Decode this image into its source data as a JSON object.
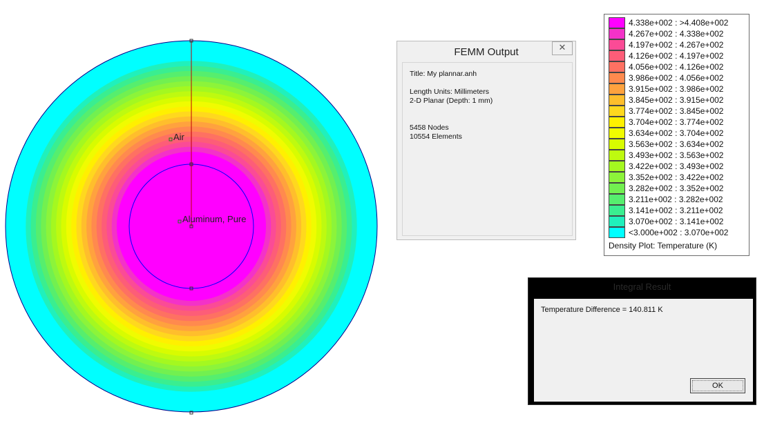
{
  "plot": {
    "region_labels": [
      "Air",
      "Aluminum, Pure"
    ],
    "outer_color": "#00ffff",
    "inner_color": "#ff00ff",
    "outer_boundary_color": "#00008b",
    "inner_boundary_color": "#0000ff",
    "line_color": "#c00000"
  },
  "femm_output": {
    "title": "FEMM Output",
    "close_glyph": "✕",
    "lines": [
      "Title: My plannar.anh",
      "Length Units: Millimeters",
      "2-D Planar (Depth: 1 mm)",
      "5458 Nodes",
      "10554 Elements"
    ]
  },
  "legend": {
    "title": "Density Plot: Temperature (K)",
    "entries": [
      {
        "label": "4.338e+002 : >4.408e+002",
        "color": "#ff00ff"
      },
      {
        "label": "4.267e+002 : 4.338e+002",
        "color": "#f332c8"
      },
      {
        "label": "4.197e+002 : 4.267e+002",
        "color": "#fb4b96"
      },
      {
        "label": "4.126e+002 : 4.197e+002",
        "color": "#fd5d78"
      },
      {
        "label": "4.056e+002 : 4.126e+002",
        "color": "#fe7162"
      },
      {
        "label": "3.986e+002 : 4.056e+002",
        "color": "#ff8a4e"
      },
      {
        "label": "3.915e+002 : 3.986e+002",
        "color": "#ffa23e"
      },
      {
        "label": "3.845e+002 : 3.915e+002",
        "color": "#ffbe2c"
      },
      {
        "label": "3.774e+002 : 3.845e+002",
        "color": "#ffd81e"
      },
      {
        "label": "3.704e+002 : 3.774e+002",
        "color": "#fff000"
      },
      {
        "label": "3.634e+002 : 3.704e+002",
        "color": "#f0fc00"
      },
      {
        "label": "3.563e+002 : 3.634e+002",
        "color": "#d8fc00"
      },
      {
        "label": "3.493e+002 : 3.563e+002",
        "color": "#befa10"
      },
      {
        "label": "3.422e+002 : 3.493e+002",
        "color": "#a4f820"
      },
      {
        "label": "3.352e+002 : 3.422e+002",
        "color": "#8cf43a"
      },
      {
        "label": "3.282e+002 : 3.352e+002",
        "color": "#72f050"
      },
      {
        "label": "3.211e+002 : 3.282e+002",
        "color": "#56ee6e"
      },
      {
        "label": "3.141e+002 : 3.211e+002",
        "color": "#3aee90"
      },
      {
        "label": "3.070e+002 : 3.141e+002",
        "color": "#20f0bc"
      },
      {
        "label": "<3.000e+002 : 3.070e+002",
        "color": "#00ffff"
      }
    ]
  },
  "integral_result": {
    "title": "Integral Result",
    "message": "Temperature Difference = 140.811 K",
    "ok_label": "OK"
  }
}
